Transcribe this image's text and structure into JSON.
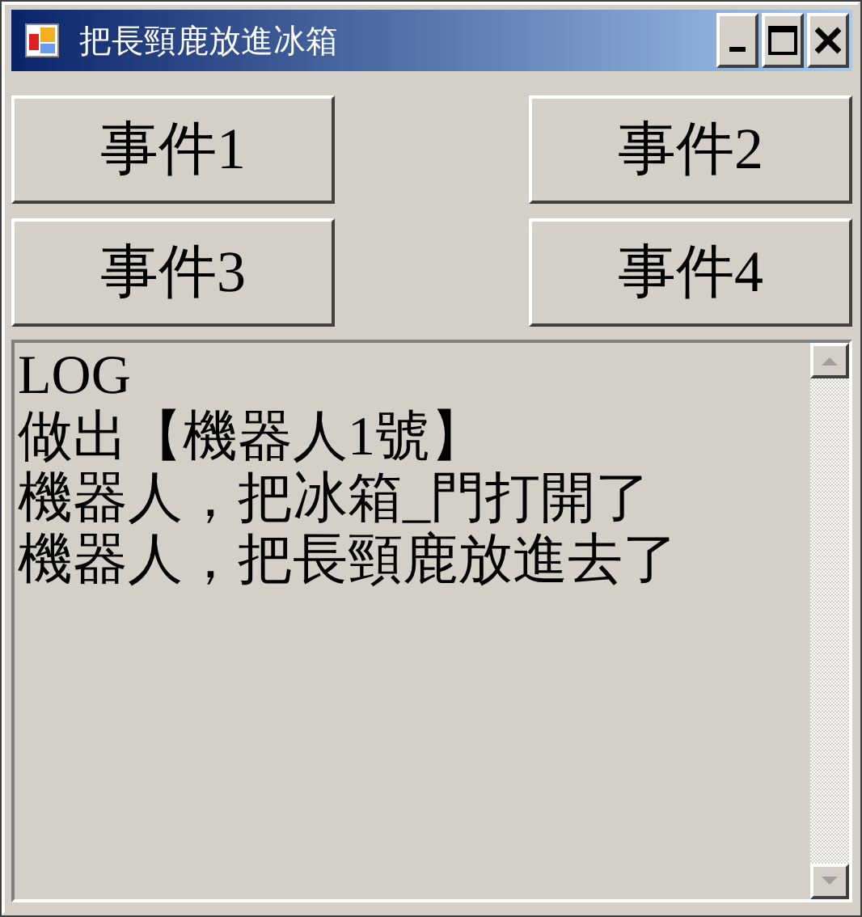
{
  "window": {
    "title": "把長頸鹿放進冰箱"
  },
  "buttons": [
    {
      "label": "事件1"
    },
    {
      "label": "事件2"
    },
    {
      "label": "事件3"
    },
    {
      "label": "事件4"
    }
  ],
  "log": {
    "lines": [
      "LOG",
      "做出【機器人1號】",
      "機器人，把冰箱_門打開了",
      "機器人，把長頸鹿放進去了"
    ]
  }
}
